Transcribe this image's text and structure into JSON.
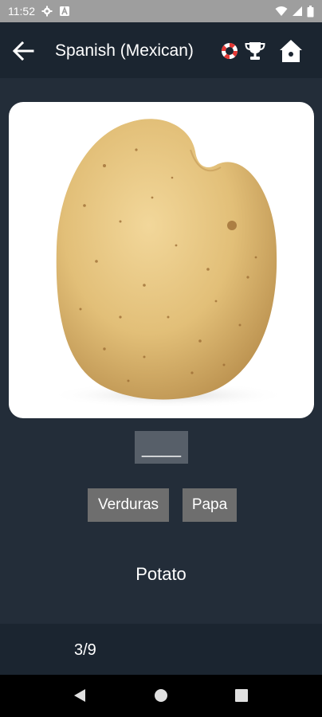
{
  "status_bar": {
    "time": "11:52",
    "icons": [
      "gear-icon",
      "a-notification-icon",
      "wifi-icon",
      "signal-icon",
      "battery-icon"
    ]
  },
  "app_bar": {
    "title": "Spanish (Mexican)",
    "icons": [
      "back-arrow-icon",
      "lifebuoy-icon",
      "trophy-icon",
      "home-icon"
    ]
  },
  "quiz": {
    "image_subject": "potato",
    "blank": "____",
    "options": [
      "Verduras",
      "Papa"
    ],
    "translation": "Potato"
  },
  "footer": {
    "progress": "3/9"
  },
  "nav_bar": {
    "icons": [
      "nav-back-icon",
      "nav-home-icon",
      "nav-recents-icon"
    ]
  },
  "colors": {
    "background": "#232d39",
    "app_bar": "#1b2530",
    "option_button": "#6e6e6e",
    "blank_box": "#575f69",
    "status_bar": "#9e9e9e"
  }
}
